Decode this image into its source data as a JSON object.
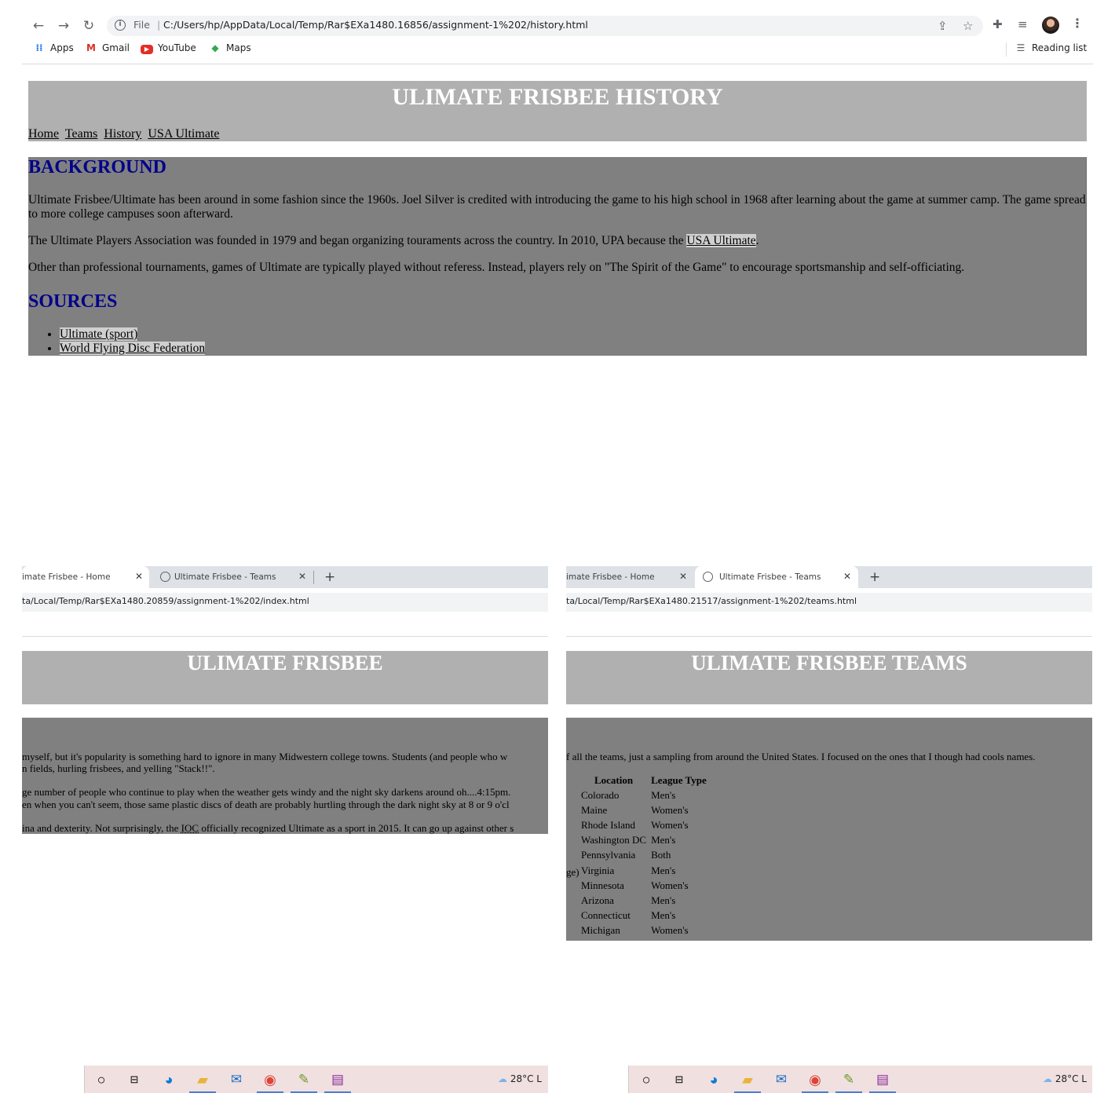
{
  "top_window": {
    "omnibox": {
      "file_label": "File",
      "separator": "|",
      "url": "C:/Users/hp/AppData/Local/Temp/Rar$EXa1480.16856/assignment-1%202/history.html"
    },
    "bookmarks": [
      {
        "label": "Apps",
        "icon": "apps-grid-icon"
      },
      {
        "label": "Gmail",
        "icon": "gmail-icon"
      },
      {
        "label": "YouTube",
        "icon": "youtube-icon"
      },
      {
        "label": "Maps",
        "icon": "maps-icon"
      }
    ],
    "reading_list": "Reading list"
  },
  "history_page": {
    "title": "ULIMATE FRISBEE HISTORY",
    "nav": [
      "Home",
      "Teams",
      "History",
      "USA Ultimate"
    ],
    "background_heading": "BACKGROUND",
    "paragraphs": {
      "p1": "Ultimate Frisbee/Ultimate has been around in some fashion since the 1960s. Joel Silver is credited with introducing the game to his high school in 1968 after learning about the game at summer camp. The game spread to more college campuses soon afterward.",
      "p2_before": "The Ultimate Players Association was founded in 1979 and began organizing touraments across the country. In 2010, UPA because the ",
      "p2_link": "USA Ultimate",
      "p2_after": ".",
      "p3": "Other than professional tournaments, games of Ultimate are typically played without referess. Instead, players rely on \"The Spirit of the Game\" to encourage sportsmanship and self-officiating."
    },
    "sources_heading": "SOURCES",
    "sources": [
      "Ultimate (sport)",
      "World Flying Disc Federation"
    ]
  },
  "left_window": {
    "tabs": [
      {
        "label": "imate Frisbee - Home",
        "close": "✕"
      },
      {
        "label": "Ultimate Frisbee - Teams",
        "close": "✕"
      }
    ],
    "new_tab": "+",
    "address": "ta/Local/Temp/Rar$EXa1480.20859/assignment-1%202/index.html",
    "title": "ULIMATE FRISBEE",
    "lines": {
      "l1": " myself, but it's popularity is something hard to ignore in many Midwestern college towns. Students (and people who w",
      "l2": "n fields, hurling frisbees, and yelling \"Stack!!\".",
      "l3": "ge number of people who continue to play when the weather gets windy and the night sky darkens around oh....4:15pm.",
      "l4": "en when you can't seem, those same plastic discs of death are probably hurtling through the dark night sky at 8 or 9 o'cl",
      "l5_before": "ina and dexterity. Not surprisingly, the ",
      "l5_abbr": "IOC",
      "l5_after": " officially recognized Ultimate as a sport in 2015. It can go up against other s"
    },
    "weather": "28°C  L"
  },
  "right_window": {
    "tabs": [
      {
        "label": "imate Frisbee - Home",
        "close": "✕"
      },
      {
        "label": "Ultimate Frisbee - Teams",
        "close": "✕"
      }
    ],
    "new_tab": "+",
    "address": "ta/Local/Temp/Rar$EXa1480.21517/assignment-1%202/teams.html",
    "title": "ULIMATE FRISBEE TEAMS",
    "intro": "f all the teams, just a sampling from around the United States. I focused on the ones that I though had cools names.",
    "table": {
      "headers": [
        "Location",
        "League Type"
      ],
      "row_prefix": "ge)",
      "rows": [
        [
          "Colorado",
          "Men's"
        ],
        [
          "Maine",
          "Women's"
        ],
        [
          "Rhode Island",
          "Women's"
        ],
        [
          "Washington DC",
          "Men's"
        ],
        [
          "Pennsylvania",
          "Both"
        ],
        [
          "Virginia",
          "Men's"
        ],
        [
          "Minnesota",
          "Women's"
        ],
        [
          "Arizona",
          "Men's"
        ],
        [
          "Connecticut",
          "Men's"
        ],
        [
          "Michigan",
          "Women's"
        ]
      ]
    },
    "weather": "28°C  L"
  },
  "colors": {
    "header_bg": "#b0b0b0",
    "content_bg": "#808080",
    "heading_blue": "#00008b",
    "taskbar_bg": "#f1e0e0"
  }
}
